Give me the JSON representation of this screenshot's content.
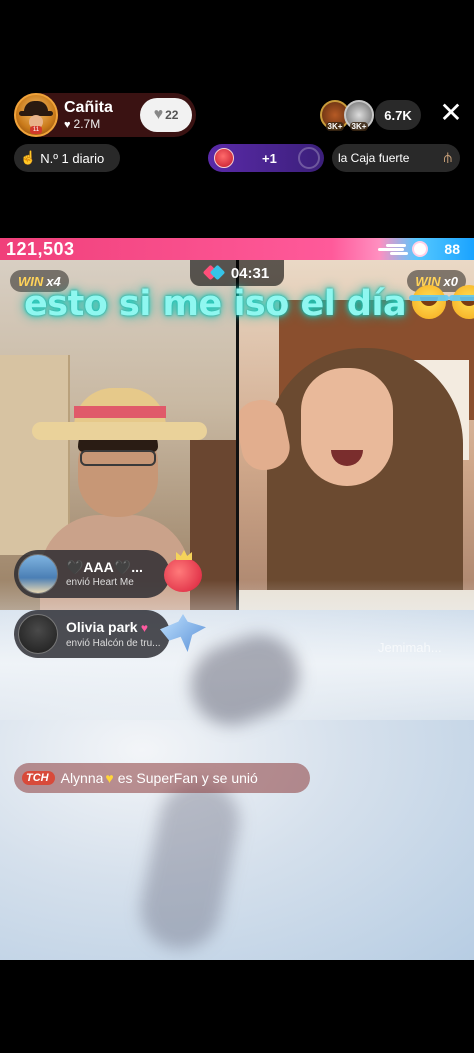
{
  "host": {
    "name": "Cañita",
    "likes": "2.7M",
    "follow_count": "22"
  },
  "viewers": {
    "avatar_badges": [
      "3K+",
      "3K+"
    ],
    "count": "6.7K"
  },
  "close_symbol": "✕",
  "pills": {
    "daily_rank": "N.º 1 diario",
    "gift_plus": "+1",
    "vault": "la Caja fuerte"
  },
  "battle": {
    "left_score": "121,503",
    "right_score": "88",
    "timer": "04:31",
    "left_win_label": "WIN",
    "left_win_count": "x4",
    "right_win_label": "WIN",
    "right_win_count": "x0"
  },
  "caption": "esto si me iso el día",
  "watermark": "Jemimah...",
  "gift_notices": [
    {
      "name": "🖤AAA🖤...",
      "subtitle": "envió Heart Me"
    },
    {
      "name": "Olivia park",
      "subtitle": "envió Halcón de tru..."
    }
  ],
  "join_notice": {
    "badge": "TCH",
    "user": "Alynna",
    "text": "es SuperFan y se unió"
  },
  "colors": {
    "left_bar": "#f0407a",
    "right_bar": "#1aa3ff",
    "caption_glow": "#1fd3c4",
    "win_gold": "#ffd35a"
  },
  "icons": [
    "heart-icon",
    "close-icon",
    "hand-point-icon",
    "gift-icon",
    "timer-icon",
    "laugh-emoji-icon",
    "crown-icon",
    "falcon-icon"
  ]
}
